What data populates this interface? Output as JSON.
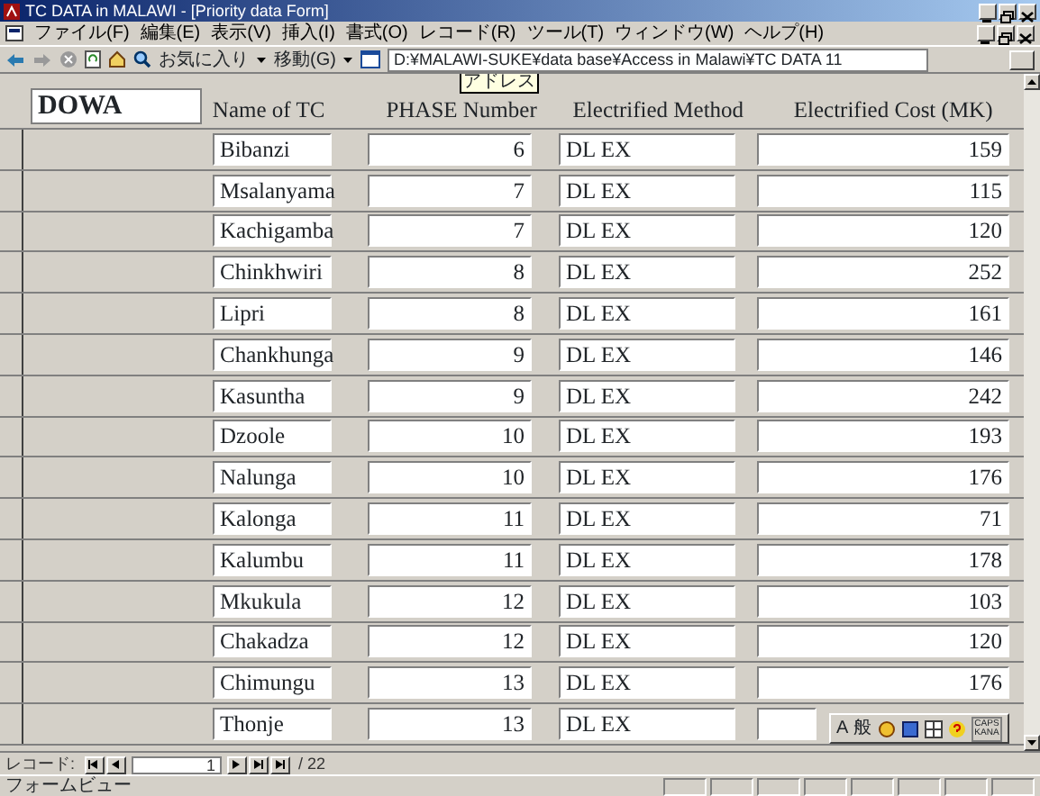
{
  "window": {
    "title": "TC DATA in MALAWI - [Priority data Form]"
  },
  "menu": [
    "ファイル(F)",
    "編集(E)",
    "表示(V)",
    "挿入(I)",
    "書式(O)",
    "レコード(R)",
    "ツール(T)",
    "ウィンドウ(W)",
    "ヘルプ(H)"
  ],
  "toolbar": {
    "favorites": "お気に入り",
    "go": "移動(G)",
    "address": "D:¥MALAWI-SUKE¥data base¥Access in Malawi¥TC DATA 11",
    "tooltip": "アドレス"
  },
  "form": {
    "district": "DOWA",
    "columns": [
      "Name of TC",
      "PHASE Number",
      "Electrified Method",
      "Electrified Cost (MK)"
    ],
    "rows": [
      {
        "name": "Bibanzi",
        "phase": "6",
        "method": "DL  EX",
        "cost": "159"
      },
      {
        "name": "Msalanyama",
        "phase": "7",
        "method": "DL  EX",
        "cost": "115"
      },
      {
        "name": "Kachigamba",
        "phase": "7",
        "method": "DL  EX",
        "cost": "120"
      },
      {
        "name": "Chinkhwiri",
        "phase": "8",
        "method": "DL  EX",
        "cost": "252"
      },
      {
        "name": "Lipri",
        "phase": "8",
        "method": "DL  EX",
        "cost": "161"
      },
      {
        "name": "Chankhunga",
        "phase": "9",
        "method": "DL  EX",
        "cost": "146"
      },
      {
        "name": "Kasuntha",
        "phase": "9",
        "method": "DL  EX",
        "cost": "242"
      },
      {
        "name": "Dzoole",
        "phase": "10",
        "method": "DL  EX",
        "cost": "193"
      },
      {
        "name": "Nalunga",
        "phase": "10",
        "method": "DL  EX",
        "cost": "176"
      },
      {
        "name": "Kalonga",
        "phase": "11",
        "method": "DL  EX",
        "cost": "71"
      },
      {
        "name": "Kalumbu",
        "phase": "11",
        "method": "DL  EX",
        "cost": "178"
      },
      {
        "name": "Mkukula",
        "phase": "12",
        "method": "DL  EX",
        "cost": "103"
      },
      {
        "name": "Chakadza",
        "phase": "12",
        "method": "DL  EX",
        "cost": "120"
      },
      {
        "name": "Chimungu",
        "phase": "13",
        "method": "DL  EX",
        "cost": "176"
      },
      {
        "name": "Thonje",
        "phase": "13",
        "method": "DL  EX"
      }
    ]
  },
  "ime_toolbar": {
    "mode": "A",
    "input": "般",
    "caps": "CAPS",
    "kana": "KANA"
  },
  "record_nav": {
    "label": "レコード:",
    "current": "1",
    "total": "/ 22"
  },
  "status_bar": "フォームビュー"
}
